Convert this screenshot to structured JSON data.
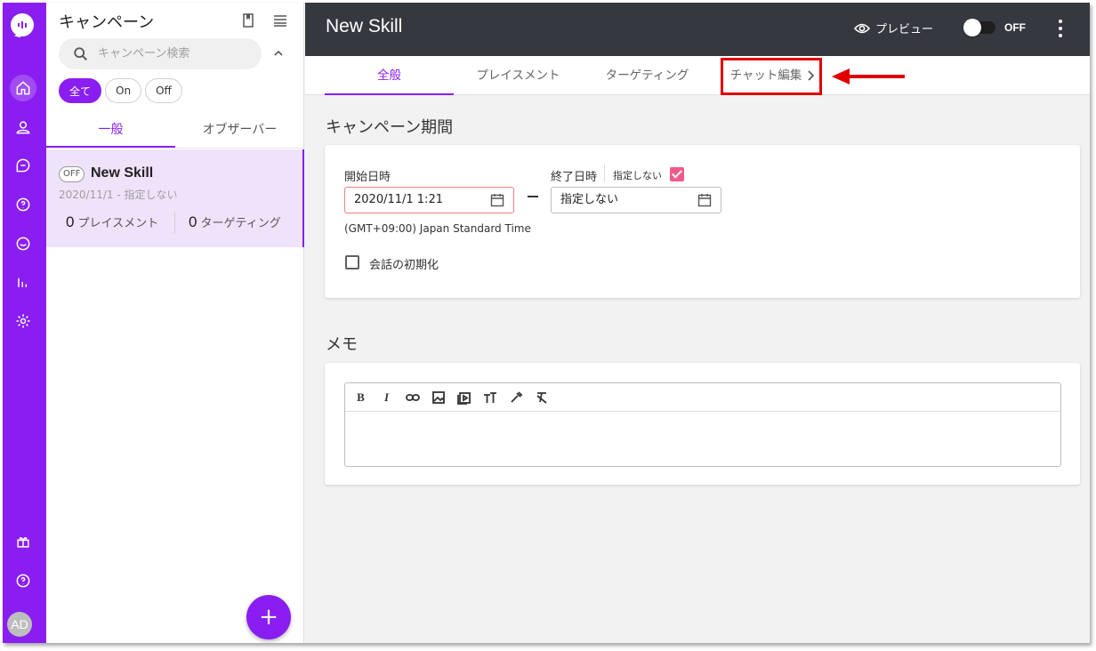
{
  "sidebar_panel": {
    "title": "キャンペーン",
    "search_placeholder": "キャンペーン検索",
    "filters": [
      "全て",
      "On",
      "Off"
    ],
    "tabs": [
      "一般",
      "オブザーバー"
    ],
    "campaign": {
      "status": "OFF",
      "name": "New Skill",
      "dates": "2020/11/1 - 指定しない",
      "placements_count": "0",
      "placements_label": "プレイスメント",
      "targeting_count": "0",
      "targeting_label": "ターゲティング"
    }
  },
  "rail": {
    "avatar_initials": "AD",
    "accent": "#8a1ef1"
  },
  "header": {
    "title": "New Skill",
    "preview_label": "プレビュー",
    "toggle_label": "OFF"
  },
  "tabs": [
    "全般",
    "プレイスメント",
    "ターゲティング",
    "チャット編集"
  ],
  "period": {
    "section_title": "キャンペーン期間",
    "start_label": "開始日時",
    "start_value": "2020/11/1 1:21",
    "end_label": "終了日時",
    "unspecified_label": "指定しない",
    "end_value": "指定しない",
    "timezone": "(GMT+09:00) Japan Standard Time",
    "reset_label": "会話の初期化"
  },
  "memo": {
    "section_title": "メモ",
    "toolbar": [
      "B",
      "I",
      "link-icon",
      "image-icon",
      "video-icon",
      "text-size-icon",
      "eyedropper-icon",
      "clear-format-icon"
    ]
  }
}
